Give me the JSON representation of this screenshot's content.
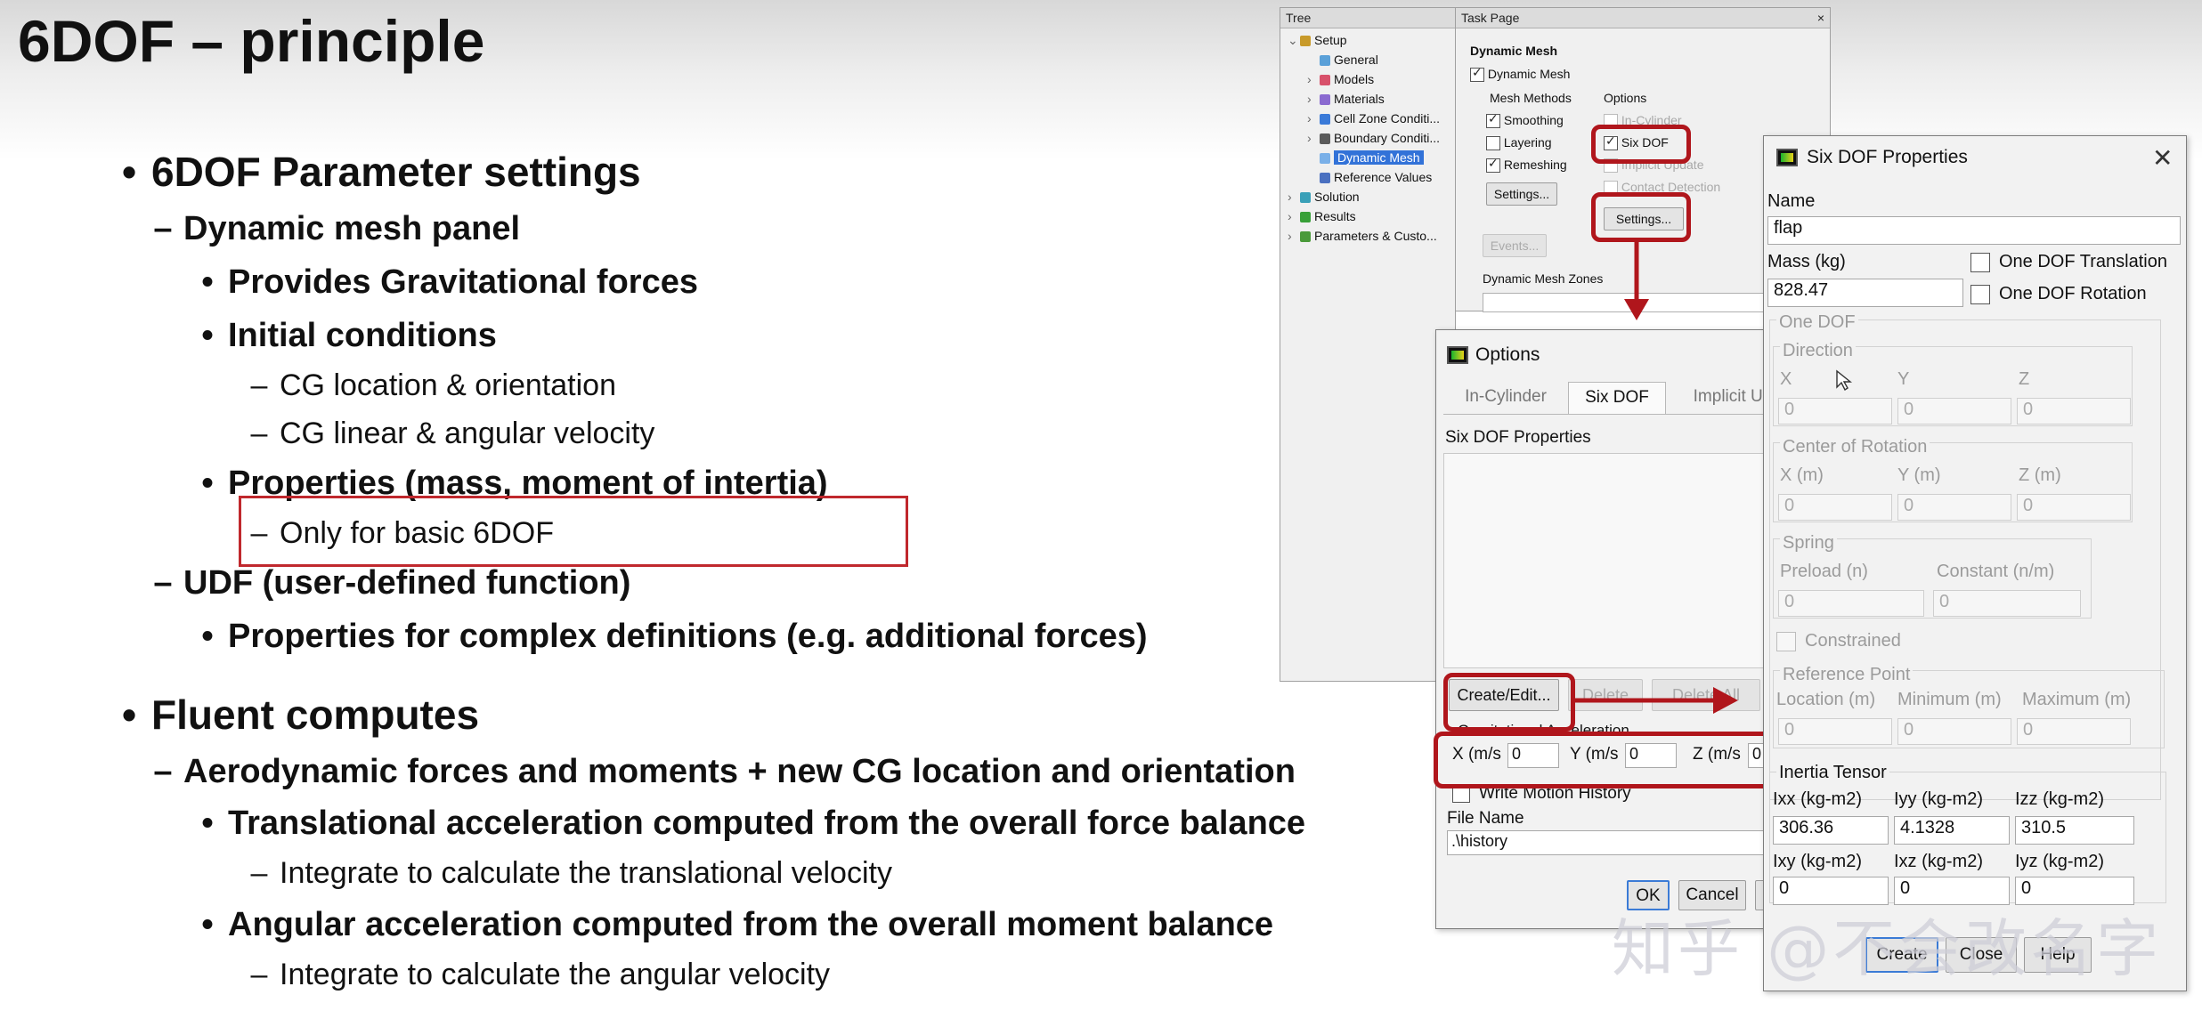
{
  "slide": {
    "title": "6DOF – principle",
    "b1": "6DOF Parameter settings",
    "b1_1": "Dynamic mesh panel",
    "b1_1_1": "Provides Gravitational forces",
    "b1_1_2": "Initial conditions",
    "b1_1_2_1": "CG location & orientation",
    "b1_1_2_2": "CG linear & angular velocity",
    "b1_1_3": "Properties (mass, moment of intertia)",
    "b1_1_3_1": "Only for basic 6DOF",
    "b1_2": "UDF (user-defined function)",
    "b1_2_1": "Properties for complex definitions (e.g. additional forces)",
    "b2": "Fluent computes",
    "b2_1": "Aerodynamic forces and moments + new CG location and orientation",
    "b2_1_1": "Translational acceleration computed from the overall force balance",
    "b2_1_1_1": "Integrate to calculate the translational velocity",
    "b2_1_2": "Angular acceleration computed from the overall moment balance",
    "b2_1_2_1": "Integrate to calculate the angular velocity",
    "bullet": "•",
    "dash": "–"
  },
  "tree": {
    "header": "Tree",
    "items": [
      {
        "label": "Setup",
        "arrow": "⌄",
        "color": "#c89a2a"
      },
      {
        "label": "General",
        "arrow": "",
        "color": "#5aa0d8"
      },
      {
        "label": "Models",
        "arrow": "›",
        "color": "#d8506a"
      },
      {
        "label": "Materials",
        "arrow": "›",
        "color": "#8a6ad0"
      },
      {
        "label": "Cell Zone Conditi...",
        "arrow": "›",
        "color": "#3a7ad8"
      },
      {
        "label": "Boundary Conditi...",
        "arrow": "›",
        "color": "#5a5a5a"
      },
      {
        "label": "Dynamic Mesh",
        "arrow": "",
        "color": "#7ab0e8"
      },
      {
        "label": "Reference Values",
        "arrow": "",
        "color": "#4a70c0"
      },
      {
        "label": "Solution",
        "arrow": "›",
        "color": "#3aa0b8"
      },
      {
        "label": "Results",
        "arrow": "›",
        "color": "#38a038"
      },
      {
        "label": "Parameters & Custo...",
        "arrow": "›",
        "color": "#4a9a3a"
      }
    ]
  },
  "task_page": {
    "header": "Task Page",
    "close": "×",
    "title": "Dynamic Mesh",
    "dynamic_mesh": "Dynamic Mesh",
    "mesh_methods": "Mesh Methods",
    "smoothing": "Smoothing",
    "layering": "Layering",
    "remeshing": "Remeshing",
    "settings1": "Settings...",
    "options": "Options",
    "in_cylinder": "In-Cylinder",
    "six_dof": "Six DOF",
    "implicit_update": "Implicit Update",
    "contact_detection": "Contact Detection",
    "settings2": "Settings...",
    "events": "Events...",
    "zones": "Dynamic Mesh Zones"
  },
  "options_dialog": {
    "title": "Options",
    "tabs": [
      "In-Cylinder",
      "Six DOF",
      "Implicit Up"
    ],
    "props_label": "Six DOF Properties",
    "create_edit": "Create/Edit...",
    "delete": "Delete",
    "delete_all": "Delete All",
    "grav_label": "Gravitational Acceleration",
    "x_label": "X (m/s",
    "x_val": "0",
    "y_label": "Y (m/s",
    "y_val": "0",
    "z_label": "Z (m/s",
    "z_val": "0",
    "write_motion": "Write Motion History",
    "file_name_label": "File Name",
    "file_name": ".\\history",
    "ok": "OK",
    "cancel": "Cancel"
  },
  "six_dof": {
    "title": "Six DOF Properties",
    "close": "✕",
    "name_label": "Name",
    "name": "flap",
    "mass_label": "Mass (kg)",
    "mass": "828.47",
    "one_dof_translation": "One DOF Translation",
    "one_dof_rotation": "One DOF Rotation",
    "one_dof": "One DOF",
    "direction": "Direction",
    "x": "X",
    "y": "Y",
    "z": "Z",
    "dir_x": "0",
    "dir_y": "0",
    "dir_z": "0",
    "center_rotation": "Center of Rotation",
    "xm": "X (m)",
    "ym": "Y (m)",
    "zm": "Z (m)",
    "cr_x": "0",
    "cr_y": "0",
    "cr_z": "0",
    "spring": "Spring",
    "preload": "Preload (n)",
    "constant": "Constant (n/m)",
    "preload_val": "0",
    "constant_val": "0",
    "constrained": "Constrained",
    "reference_point": "Reference Point",
    "location": "Location (m)",
    "minimum": "Minimum (m)",
    "maximum": "Maximum (m)",
    "loc_val": "0",
    "min_val": "0",
    "max_val": "0",
    "inertia": "Inertia Tensor",
    "ixx_label": "Ixx (kg-m2)",
    "iyy_label": "Iyy (kg-m2)",
    "izz_label": "Izz (kg-m2)",
    "ixx": "306.36",
    "iyy": "4.1328",
    "izz": "310.5",
    "ixy_label": "Ixy (kg-m2)",
    "ixz_label": "Ixz (kg-m2)",
    "iyz_label": "Iyz (kg-m2)",
    "ixy": "0",
    "ixz": "0",
    "iyz": "0",
    "create_btn": "Create",
    "close_btn": "Close",
    "help_btn": "Help"
  },
  "watermark": "知乎 @不会改名字",
  "colors": {
    "highlight": "#b0161c",
    "selection": "#3272d8"
  }
}
